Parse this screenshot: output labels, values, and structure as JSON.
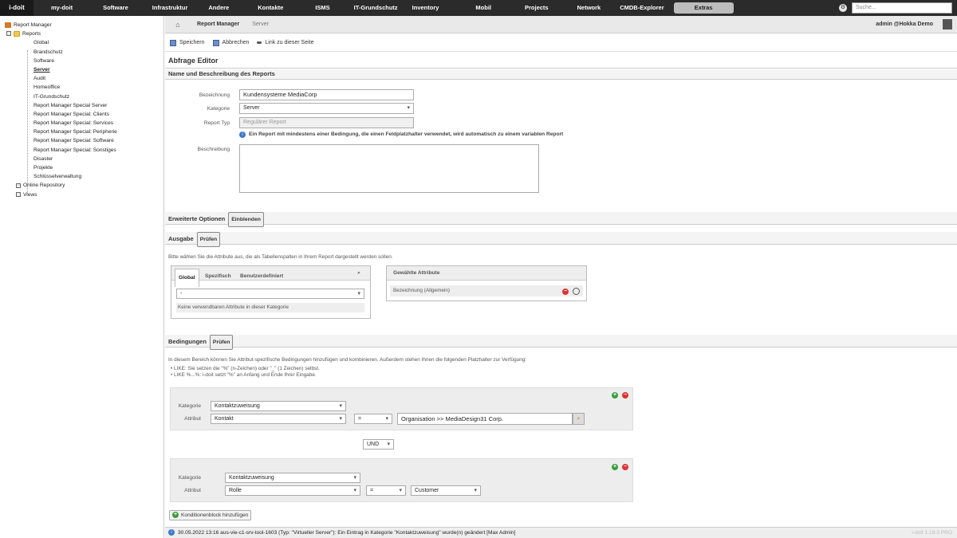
{
  "app": {
    "logo_top": "",
    "logo_bottom": "i-doit"
  },
  "topnav": {
    "items": [
      "my-doit",
      "Software",
      "Infrastruktur",
      "Andere",
      "Kontakte",
      "ISMS",
      "IT-Grundschutz",
      "Inventory",
      "Mobil",
      "Projects",
      "Network",
      "CMDB-Explorer",
      "Extras"
    ],
    "active": "Extras",
    "search_placeholder": "Suche..."
  },
  "sidebar": {
    "root": "Report Manager",
    "reports": "Reports",
    "items": [
      "Global",
      "Brandschutz",
      "Software",
      "Server",
      "Audit",
      "Homeoffice",
      "IT-Grundschutz",
      "Report Manager Special Server",
      "Report Manager Special: Clients",
      "Report Manager Special: Services",
      "Report Manager Special: Peripherie",
      "Report Manager Special: Software",
      "Report Manager Special: Sonstiges",
      "Disaster",
      "Projekte",
      "Schlüsselverwaltung"
    ],
    "selected": "Server",
    "online_repository": "Online Repository",
    "views": "Views"
  },
  "header": {
    "crumb1": "Report Manager",
    "crumb2": "Server",
    "user": "admin  @Hokka Demo"
  },
  "toolbar": {
    "save": "Speichern",
    "cancel": "Abbrechen",
    "link": "Link zu dieser Seite"
  },
  "editor": {
    "title": "Abfrage Editor",
    "section_name": "Name und Beschreibung des Reports",
    "bezeichnung_label": "Bezeichnung",
    "bezeichnung_value": "Kundensysteme MediaCorp",
    "kategorie_label": "Kategorie",
    "kategorie_value": "Server",
    "reporttyp_label": "Report Typ",
    "reporttyp_value": "Regulärer Report",
    "info_text": "Ein Report mit mindestens einer Bedingung, die einen Feldplatzhalter verwendet, wird automatisch zu einem variablen Report",
    "beschreibung_label": "Beschreibung"
  },
  "advanced": {
    "title": "Erweiterte Optionen",
    "button": "Einblenden"
  },
  "output": {
    "title": "Ausgabe",
    "button": "Prüfen",
    "hint": "Bitte wählen Sie die Attribute aus, die als Tabellenspalten in Ihrem Report dargestellt werden sollen.",
    "tabs": [
      "Global",
      "Spezifisch",
      "Benutzerdefiniert"
    ],
    "select_value": "-",
    "no_attr": "Keine verwendbaren Attribute in dieser Kategorie",
    "selected_header": "Gewählte Attribute",
    "selected_item": "Bezeichnung (Allgemein)"
  },
  "conditions": {
    "title": "Bedingungen",
    "button": "Prüfen",
    "hint": "In diesem Bereich können Sie Attribut-spezifische Bedingungen hinzufügen und kombinieren. Außerdem stehen Ihnen die folgenden Platzhalter zur Verfügung:",
    "bullet1": "• LIKE: Sie setzen die \"%\" (n-Zeichen) oder \"_\" (1 Zeichen) selbst.",
    "bullet2": "• LIKE %...%: i-doit setzt \"%\" an Anfang und Ende Ihrer Eingabe.",
    "block1": {
      "kategorie_label": "Kategorie",
      "kategorie": "Kontaktzuweisung",
      "attribut_label": "Attribut",
      "attribut": "Kontakt",
      "op": "=",
      "value": "Organisation >> MediaDesign31 Corp."
    },
    "connector": "UND",
    "block2": {
      "kategorie_label": "Kategorie",
      "kategorie": "Kontaktzuweisung",
      "attribut_label": "Attribut",
      "attribut": "Rolle",
      "op": "=",
      "value": "Customer"
    },
    "add_block": "Konditionenblock hinzufügen"
  },
  "status": {
    "text": "30.05.2022 13:16 aus-vie-c1-srv-tool-1603 (Typ: \"Virtueller Server\"): Ein Eintrag in Kategorie \"Kontaktzuweisung\" wurde(n) geändert [Max Admin]",
    "version": "i-doit 1.18.3 PRO"
  }
}
